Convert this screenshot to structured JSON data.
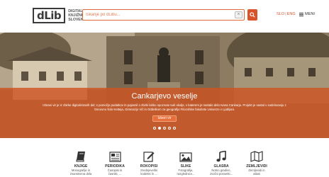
{
  "header": {
    "logo_mark": "dLib",
    "logo_lines": [
      "DIGITALNA",
      "KNJIŽNICA",
      "SLOVENIJE"
    ],
    "search_placeholder": "Iskanje po dLibu...",
    "search_clear": "×",
    "lang_sl": "SLO",
    "lang_sep": "|",
    "lang_en": "ENG",
    "menu_label": "MENI",
    "accent_color": "#d9532b"
  },
  "hero": {
    "title": "Cankarjevo veselje",
    "description": "Izbrani vir je iz zbirke digitaliziranih del; s pomočjo podatkov in pojasnil o zbirki lahko spoznate tudi okolje, v katerem je nastalo delo Ivana Cankarja. Projekt je nastal v sodelovanju z Osnovno šolo Ketteja, Gimnazijo Vič in Oddelkom za geografijo Filozofske fakultete Univerze v Ljubljani.",
    "button_label": "Izberi vir",
    "slides_total": 5,
    "active_slide": 1
  },
  "categories": [
    {
      "icon": "book-icon",
      "title": "KNJIGE",
      "sub1": "Monografije in",
      "sub2": "znanstvena dela"
    },
    {
      "icon": "newspaper-icon",
      "title": "PERIODIKA",
      "sub1": "Časopisi in",
      "sub2": "časniki, ..."
    },
    {
      "icon": "manuscript-icon",
      "title": "ROKOPISI",
      "sub1": "Srednjeveški",
      "sub2": "kodeksi in ..."
    },
    {
      "icon": "image-icon",
      "title": "SLIKE",
      "sub1": "Fotografije,",
      "sub2": "razglednice..."
    },
    {
      "icon": "music-icon",
      "title": "GLASBA",
      "sub1": "Notno gradivo,",
      "sub2": "zvočni posnetki..."
    },
    {
      "icon": "map-icon",
      "title": "ZEMLJEVIDI",
      "sub1": "Zemljevidi in",
      "sub2": "atlasi"
    }
  ]
}
